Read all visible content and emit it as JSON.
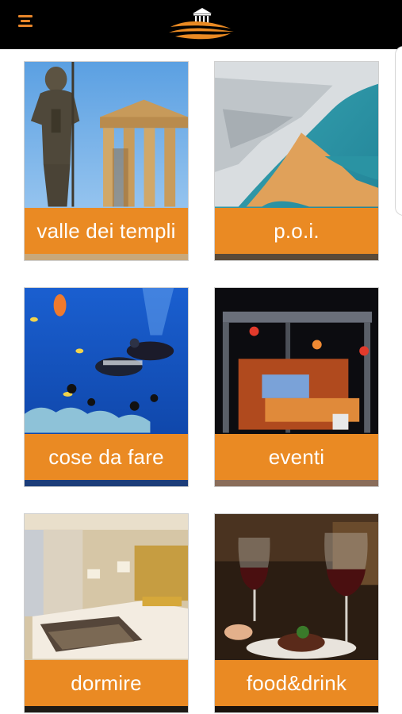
{
  "header": {
    "menu_icon": "hamburger-menu-icon",
    "logo_icon": "temple-waves-logo-icon",
    "accent_color": "#ea8a23",
    "background_color": "#000000"
  },
  "tiles": [
    {
      "label": "valle dei templi",
      "image": "greek-temple-statue"
    },
    {
      "label": "p.o.i.",
      "image": "white-cliff-coast"
    },
    {
      "label": "cose da fare",
      "image": "scuba-divers-reef"
    },
    {
      "label": "eventi",
      "image": "concert-stage-night"
    },
    {
      "label": "dormire",
      "image": "hotel-bedroom"
    },
    {
      "label": "food&drink",
      "image": "wine-glasses-dinner"
    }
  ]
}
